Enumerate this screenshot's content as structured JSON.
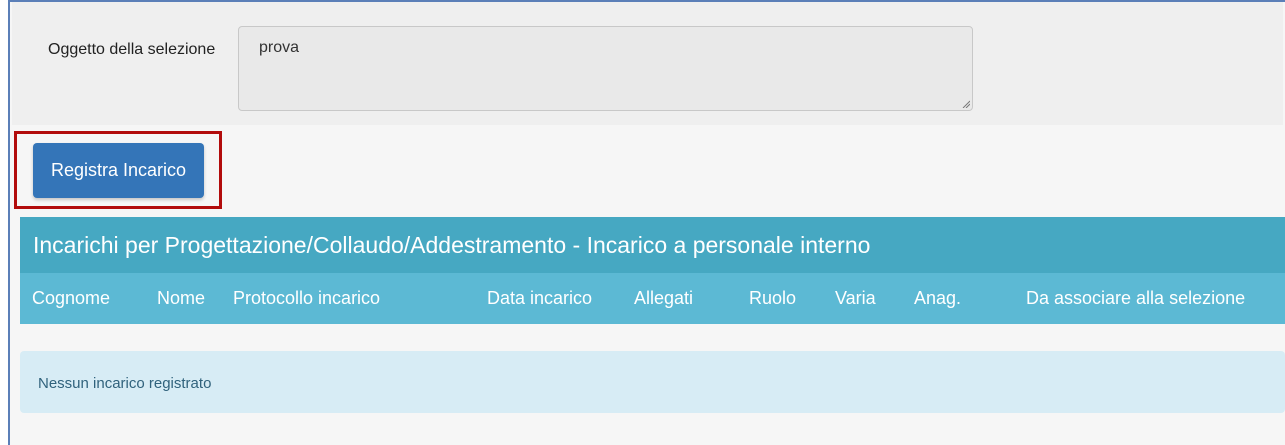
{
  "form": {
    "subject_label": "Oggetto della selezione",
    "subject_value": "prova"
  },
  "actions": {
    "register_label": "Registra Incarico"
  },
  "panel": {
    "title": "Incarichi per Progettazione/Collaudo/Addestramento - Incarico a personale interno"
  },
  "table": {
    "columns": [
      "Cognome",
      "Nome",
      "Protocollo incarico",
      "Data incarico",
      "Allegati",
      "Ruolo",
      "Varia",
      "Anag.",
      "Da associare alla selezione"
    ],
    "empty_message": "Nessun incarico registrato"
  },
  "colors": {
    "button": "#3475b8",
    "header": "#46a8c2",
    "table_head": "#5cb9d4",
    "highlight": "#b20c0c",
    "empty_row": "#d7ecf5"
  }
}
